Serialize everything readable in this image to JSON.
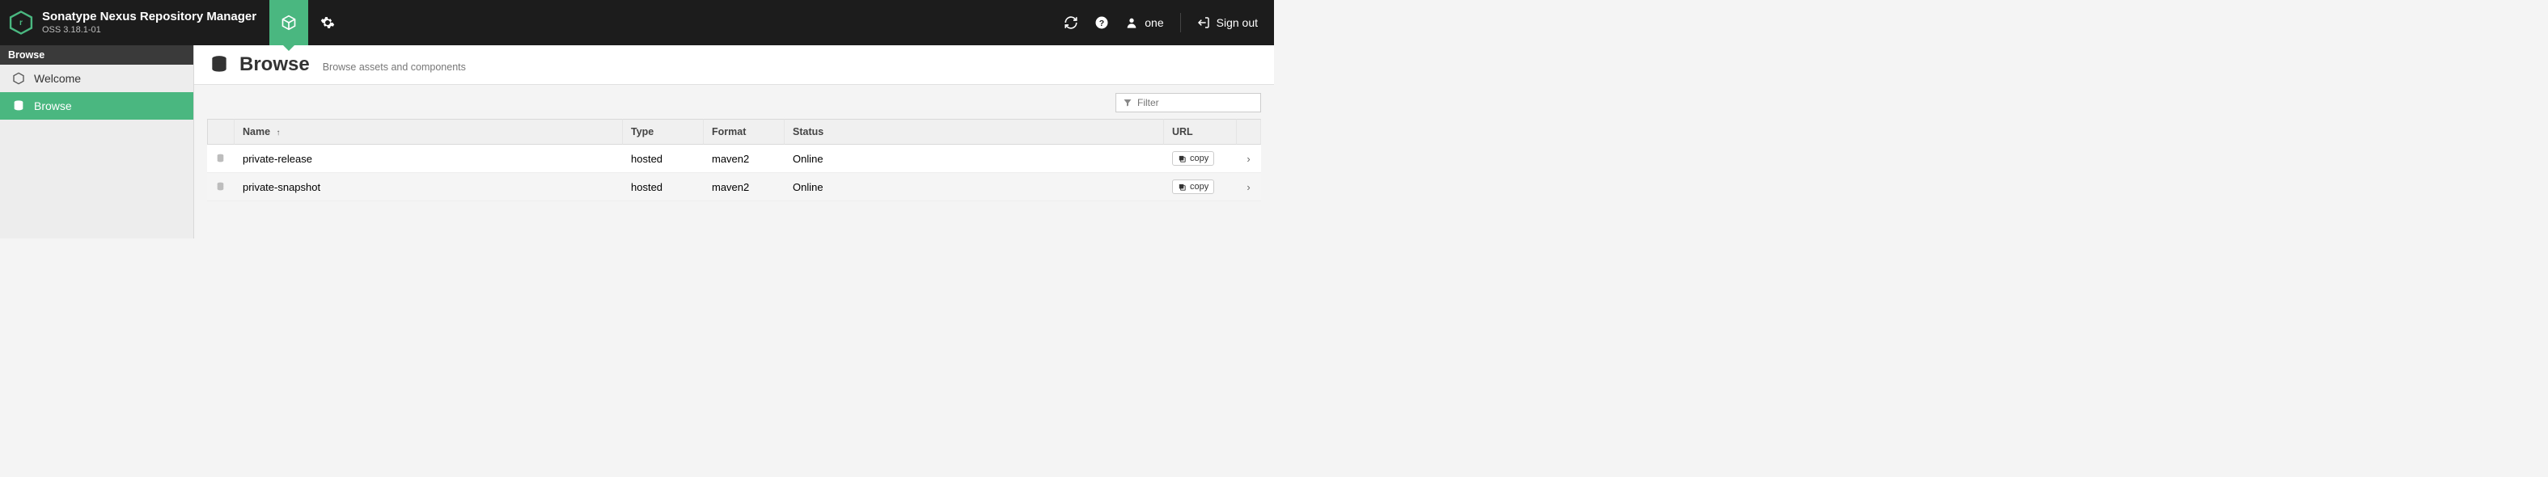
{
  "brand": {
    "title": "Sonatype Nexus Repository Manager",
    "version": "OSS 3.18.1-01"
  },
  "header": {
    "user_label": "one",
    "signout_label": "Sign out"
  },
  "sidebar": {
    "header": "Browse",
    "items": [
      {
        "label": "Welcome",
        "icon": "hexagon-icon",
        "selected": false
      },
      {
        "label": "Browse",
        "icon": "database-icon",
        "selected": true
      }
    ]
  },
  "page": {
    "title": "Browse",
    "subtitle": "Browse assets and components"
  },
  "filter": {
    "placeholder": "Filter"
  },
  "table": {
    "columns": {
      "name": "Name",
      "type": "Type",
      "format": "Format",
      "status": "Status",
      "url": "URL"
    },
    "sort_indicator": "↑",
    "copy_label": "copy",
    "rows": [
      {
        "name": "private-release",
        "type": "hosted",
        "format": "maven2",
        "status": "Online"
      },
      {
        "name": "private-snapshot",
        "type": "hosted",
        "format": "maven2",
        "status": "Online"
      }
    ]
  },
  "colors": {
    "accent": "#4ab780",
    "header_bg": "#1c1c1c"
  }
}
